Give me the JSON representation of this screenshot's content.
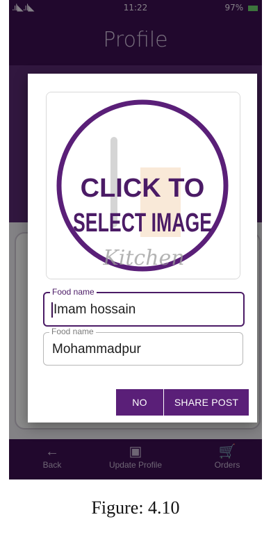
{
  "status_bar": {
    "signal": ".ıl◣.ıl◣",
    "time": "11:22",
    "battery": "97%"
  },
  "app_bar": {
    "title": "Profile"
  },
  "dialog": {
    "image_placeholder": {
      "line1": "CLICK TO",
      "line2": "SELECT IMAGE",
      "brand": "Kitchen"
    },
    "fields": [
      {
        "label": "Food name",
        "value": "Imam hossain",
        "focused": true
      },
      {
        "label": "Food name",
        "value": "Mohammadpur",
        "focused": false
      }
    ],
    "buttons": {
      "no": "NO",
      "share": "SHARE POST"
    }
  },
  "bottom_nav": [
    {
      "label": "Back",
      "icon": "arrow-back-icon"
    },
    {
      "label": "Update Profile",
      "icon": "account-box-icon"
    },
    {
      "label": "Orders",
      "icon": "cart-icon"
    }
  ],
  "caption": "Figure: 4.10",
  "colors": {
    "primary": "#3d1053",
    "accent": "#5a1f78",
    "focus": "#4b1b66"
  }
}
